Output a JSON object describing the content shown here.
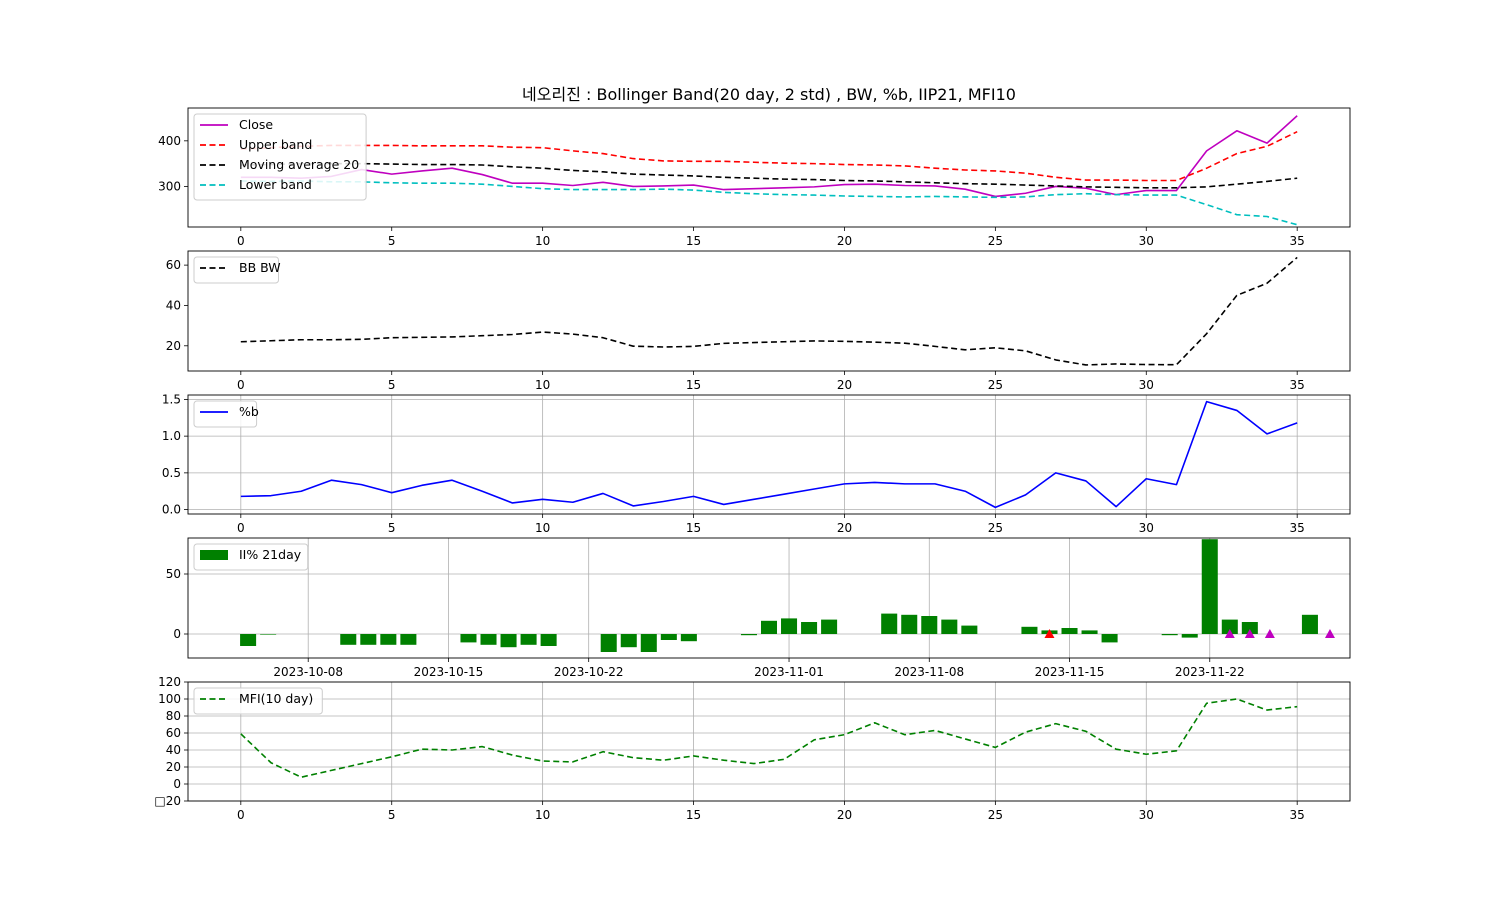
{
  "title": "네오리진 : Bollinger Band(20 day, 2 std) , BW, %b, IIP21, MFI10",
  "chart_data": [
    {
      "type": "line",
      "x": [
        0,
        1,
        2,
        3,
        4,
        5,
        6,
        7,
        8,
        9,
        10,
        11,
        12,
        13,
        14,
        15,
        16,
        17,
        18,
        19,
        20,
        21,
        22,
        23,
        24,
        25,
        26,
        27,
        28,
        29,
        30,
        31,
        32,
        33,
        34,
        35
      ],
      "xlim": [
        -1.75,
        36.75
      ],
      "ylim": [
        211,
        472
      ],
      "xticks": [
        0,
        5,
        10,
        15,
        20,
        25,
        30,
        35
      ],
      "yticks": [
        300,
        400
      ],
      "legend": "upper-left",
      "grid": false,
      "series": [
        {
          "name": "Close",
          "color": "#bf00bf",
          "dash": "solid",
          "values": [
            320,
            320,
            318,
            322,
            337,
            327,
            334,
            340,
            326,
            307,
            307,
            302,
            309,
            300,
            301,
            303,
            293,
            295,
            297,
            299,
            304,
            305,
            302,
            301,
            294,
            278,
            285,
            300,
            296,
            282,
            291,
            291,
            378,
            422,
            395,
            455
          ]
        },
        {
          "name": "Upper band",
          "color": "#ff0000",
          "dash": "dashed",
          "values": [
            382,
            385,
            388,
            390,
            390,
            390,
            389,
            389,
            389,
            386,
            385,
            378,
            372,
            361,
            356,
            355,
            355,
            353,
            351,
            350,
            348,
            347,
            345,
            340,
            336,
            334,
            329,
            320,
            314,
            314,
            313,
            313,
            340,
            372,
            388,
            420
          ]
        },
        {
          "name": "Moving average 20",
          "color": "#000000",
          "dash": "dashed",
          "values": [
            347,
            348,
            350,
            350,
            350,
            349,
            348,
            348,
            347,
            343,
            340,
            335,
            332,
            327,
            325,
            323,
            320,
            318,
            316,
            315,
            313,
            312,
            310,
            308,
            306,
            305,
            303,
            301,
            299,
            298,
            297,
            297,
            299,
            305,
            311,
            318
          ]
        },
        {
          "name": "Lower band",
          "color": "#00bfbf",
          "dash": "dashed",
          "values": [
            312,
            311,
            312,
            310,
            310,
            308,
            307,
            307,
            305,
            300,
            295,
            293,
            293,
            293,
            294,
            292,
            287,
            284,
            282,
            281,
            279,
            278,
            277,
            278,
            277,
            276,
            277,
            282,
            284,
            282,
            281,
            281,
            260,
            238,
            234,
            216
          ]
        }
      ]
    },
    {
      "type": "line",
      "x": [
        0,
        1,
        2,
        3,
        4,
        5,
        6,
        7,
        8,
        9,
        10,
        11,
        12,
        13,
        14,
        15,
        16,
        17,
        18,
        19,
        20,
        21,
        22,
        23,
        24,
        25,
        26,
        27,
        28,
        29,
        30,
        31,
        32,
        33,
        34,
        35
      ],
      "xlim": [
        -1.75,
        36.75
      ],
      "ylim": [
        7.5,
        67
      ],
      "xticks": [
        0,
        5,
        10,
        15,
        20,
        25,
        30,
        35
      ],
      "yticks": [
        20,
        40,
        60
      ],
      "legend": "upper-left",
      "grid": false,
      "series": [
        {
          "name": "BB BW",
          "color": "#000000",
          "dash": "dashed",
          "values": [
            22,
            22.5,
            23,
            23,
            23.2,
            24,
            24.2,
            24.4,
            25,
            25.6,
            26.8,
            25.8,
            24,
            19.8,
            19.4,
            19.7,
            21.2,
            21.6,
            22,
            22.4,
            22.2,
            21.8,
            21.3,
            19.7,
            18,
            19,
            17.5,
            13,
            10.5,
            11,
            10.7,
            10.6,
            26,
            45,
            51,
            63.8
          ]
        }
      ]
    },
    {
      "type": "line",
      "x": [
        0,
        1,
        2,
        3,
        4,
        5,
        6,
        7,
        8,
        9,
        10,
        11,
        12,
        13,
        14,
        15,
        16,
        17,
        18,
        19,
        20,
        21,
        22,
        23,
        24,
        25,
        26,
        27,
        28,
        29,
        30,
        31,
        32,
        33,
        34,
        35
      ],
      "xlim": [
        -1.75,
        36.75
      ],
      "ylim": [
        -0.06,
        1.56
      ],
      "xticks": [
        0,
        5,
        10,
        15,
        20,
        25,
        30,
        35
      ],
      "yticks": [
        0.0,
        0.5,
        1.0,
        1.5
      ],
      "yticklabels": [
        "0.0",
        "0.5",
        "1.0",
        "1.5"
      ],
      "legend": "upper-left",
      "grid": true,
      "series": [
        {
          "name": "%b",
          "color": "#0000ff",
          "dash": "solid",
          "values": [
            0.18,
            0.19,
            0.25,
            0.4,
            0.34,
            0.23,
            0.33,
            0.4,
            0.25,
            0.09,
            0.14,
            0.1,
            0.22,
            0.05,
            0.11,
            0.18,
            0.07,
            0.14,
            0.21,
            0.28,
            0.35,
            0.37,
            0.35,
            0.35,
            0.25,
            0.03,
            0.2,
            0.5,
            0.39,
            0.04,
            0.42,
            0.34,
            1.47,
            1.35,
            1.03,
            1.18
          ]
        }
      ]
    },
    {
      "type": "bar",
      "dates": [
        "2023-10-05",
        "2023-10-06",
        "2023-10-10",
        "2023-10-11",
        "2023-10-12",
        "2023-10-13",
        "2023-10-16",
        "2023-10-17",
        "2023-10-18",
        "2023-10-19",
        "2023-10-20",
        "2023-10-23",
        "2023-10-24",
        "2023-10-25",
        "2023-10-26",
        "2023-10-27",
        "2023-10-30",
        "2023-10-31",
        "2023-11-01",
        "2023-11-02",
        "2023-11-03",
        "2023-11-06",
        "2023-11-07",
        "2023-11-08",
        "2023-11-09",
        "2023-11-10",
        "2023-11-13",
        "2023-11-14",
        "2023-11-15",
        "2023-11-16",
        "2023-11-17",
        "2023-11-20",
        "2023-11-21",
        "2023-11-22",
        "2023-11-23",
        "2023-11-24",
        "2023-11-27"
      ],
      "values": [
        -10,
        0,
        -9,
        -9,
        -9,
        -9,
        -7,
        -9,
        -11,
        -9,
        -10,
        -15,
        -11,
        -15,
        -5,
        -6,
        -1,
        11,
        13,
        10,
        12,
        17,
        16,
        15,
        12,
        7,
        6,
        3,
        5,
        3,
        -7,
        -1,
        -3,
        79,
        12,
        10,
        16
      ],
      "xticklabels": [
        "2023-10-08",
        "2023-10-15",
        "2023-10-22",
        "2023-11-01",
        "2023-11-08",
        "2023-11-15",
        "2023-11-22"
      ],
      "xticks_at": [
        "2023-10-08",
        "2023-10-15",
        "2023-10-22",
        "2023-11-01",
        "2023-11-08",
        "2023-11-15",
        "2023-11-22"
      ],
      "xlim": [
        "2023-10-02",
        "2023-11-29"
      ],
      "ylim": [
        -20,
        80
      ],
      "yticks": [
        0,
        50
      ],
      "legend": "upper-left",
      "grid": true,
      "bar_color": "#008000",
      "series": [
        {
          "name": "II% 21day",
          "values": [
            -10,
            0,
            -9,
            -9,
            -9,
            -9,
            -7,
            -9,
            -11,
            -9,
            -10,
            -15,
            -11,
            -15,
            -5,
            -6,
            -1,
            11,
            13,
            10,
            12,
            17,
            16,
            15,
            12,
            7,
            6,
            3,
            5,
            3,
            -7,
            -1,
            -3,
            79,
            12,
            10,
            16
          ]
        }
      ],
      "markers": [
        {
          "date": "2023-11-14",
          "value": 0,
          "color": "#ff0000",
          "shape": "triangle-up"
        },
        {
          "date": "2023-11-23",
          "value": 0,
          "color": "#bf00bf",
          "shape": "triangle-up"
        },
        {
          "date": "2023-11-24",
          "value": 0,
          "color": "#bf00bf",
          "shape": "triangle-up"
        },
        {
          "date": "2023-11-25",
          "value": 0,
          "color": "#bf00bf",
          "shape": "triangle-up"
        },
        {
          "date": "2023-11-28",
          "value": 0,
          "color": "#bf00bf",
          "shape": "triangle-up"
        }
      ]
    },
    {
      "type": "line",
      "x": [
        0,
        1,
        2,
        3,
        4,
        5,
        6,
        7,
        8,
        9,
        10,
        11,
        12,
        13,
        14,
        15,
        16,
        17,
        18,
        19,
        20,
        21,
        22,
        23,
        24,
        25,
        26,
        27,
        28,
        29,
        30,
        31,
        32,
        33,
        34,
        35
      ],
      "xlim": [
        -1.75,
        36.75
      ],
      "ylim": [
        -20,
        120
      ],
      "xticks": [
        0,
        5,
        10,
        15,
        20,
        25,
        30,
        35
      ],
      "yticks": [
        -20,
        0,
        20,
        40,
        60,
        80,
        100,
        120
      ],
      "yticklabels": [
        "□20",
        "0",
        "20",
        "40",
        "60",
        "80",
        "100",
        "120"
      ],
      "legend": "upper-left",
      "grid": true,
      "series": [
        {
          "name": "MFI(10 day)",
          "color": "#008000",
          "dash": "dashed",
          "values": [
            59,
            25,
            8,
            16,
            24,
            32,
            41,
            40,
            44,
            34,
            27,
            26,
            38,
            31,
            28,
            33,
            28,
            24,
            29,
            52,
            58,
            72,
            58,
            63,
            53,
            43,
            61,
            71,
            62,
            41,
            35,
            39,
            95,
            100,
            87,
            91
          ]
        }
      ]
    }
  ]
}
